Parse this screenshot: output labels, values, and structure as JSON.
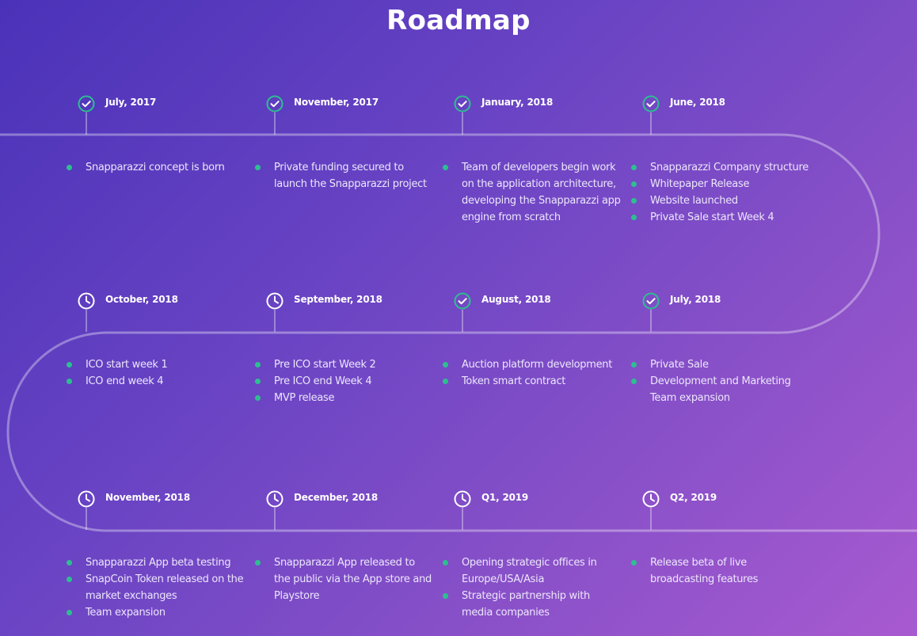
{
  "page": {
    "title": "Roadmap"
  },
  "colors": {
    "bullet": "#2dbf8f",
    "check_ring": "#2dbf8f",
    "clock_ring": "#ffffff",
    "track": "rgba(255,255,255,0.35)"
  },
  "rows": [
    {
      "milestones": [
        {
          "date": "July, 2017",
          "status": "done",
          "icon": "check-icon",
          "items": [
            "Snapparazzi concept is born"
          ]
        },
        {
          "date": "November, 2017",
          "status": "done",
          "icon": "check-icon",
          "items": [
            "Private funding secured to launch the Snapparazzi project"
          ]
        },
        {
          "date": "January, 2018",
          "status": "done",
          "icon": "check-icon",
          "items": [
            "Team of developers begin work on the application architecture, developing the Snapparazzi app engine from scratch"
          ]
        },
        {
          "date": "June, 2018",
          "status": "done",
          "icon": "check-icon",
          "items": [
            "Snapparazzi Company structure",
            "Whitepaper Release",
            "Website launched",
            "Private Sale start Week 4"
          ]
        }
      ]
    },
    {
      "milestones": [
        {
          "date": "October, 2018",
          "status": "pending",
          "icon": "clock-icon",
          "items": [
            "ICO start week 1",
            "ICO end week 4"
          ]
        },
        {
          "date": "September, 2018",
          "status": "pending",
          "icon": "clock-icon",
          "items": [
            "Pre ICO start Week 2",
            "Pre ICO end Week 4",
            "MVP release"
          ]
        },
        {
          "date": "August, 2018",
          "status": "done",
          "icon": "check-icon",
          "items": [
            "Auction platform development",
            "Token smart contract"
          ]
        },
        {
          "date": "July, 2018",
          "status": "done",
          "icon": "check-icon",
          "items": [
            "Private Sale",
            "Development and Marketing Team expansion"
          ]
        }
      ]
    },
    {
      "milestones": [
        {
          "date": "November, 2018",
          "status": "pending",
          "icon": "clock-icon",
          "items": [
            "Snapparazzi App beta testing",
            "SnapCoin Token released on the market exchanges",
            "Team expansion"
          ]
        },
        {
          "date": "December, 2018",
          "status": "pending",
          "icon": "clock-icon",
          "items": [
            "Snapparazzi App released to the public via the App store and Playstore"
          ]
        },
        {
          "date": "Q1, 2019",
          "status": "pending",
          "icon": "clock-icon",
          "items": [
            "Opening strategic offices in Europe/USA/Asia",
            "Strategic partnership with media companies"
          ]
        },
        {
          "date": "Q2, 2019",
          "status": "pending",
          "icon": "clock-icon",
          "items": [
            "Release beta of live broadcasting features"
          ]
        }
      ]
    }
  ]
}
